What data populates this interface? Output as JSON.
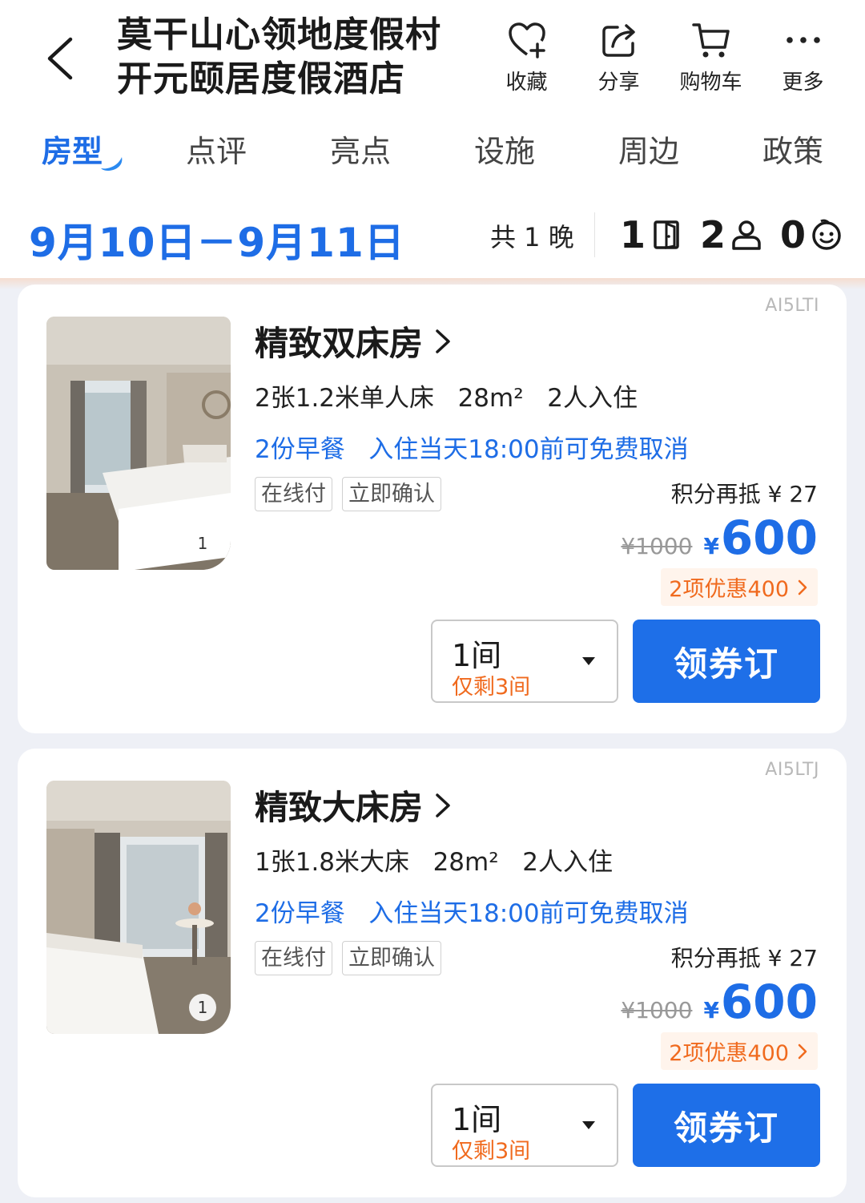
{
  "header": {
    "hotel_name_line1": "莫干山心领地度假村",
    "hotel_name_line2": "开元颐居度假酒店",
    "actions": [
      {
        "label": "收藏",
        "icon": "heart-plus-icon"
      },
      {
        "label": "分享",
        "icon": "share-icon"
      },
      {
        "label": "购物车",
        "icon": "cart-icon"
      },
      {
        "label": "更多",
        "icon": "more-icon"
      }
    ]
  },
  "tabs": [
    "房型",
    "点评",
    "亮点",
    "设施",
    "周边",
    "政策"
  ],
  "active_tab": "房型",
  "stay": {
    "date_range": "9月10日－9月11日",
    "nights": "共 1 晚",
    "rooms": "1",
    "adults": "2",
    "children": "0"
  },
  "rooms": [
    {
      "code": "AI5LTI",
      "name": "精致双床房",
      "spec": "2张1.2米单人床   28m²   2人入住",
      "perk": "2份早餐   入住当天18:00前可免费取消",
      "tags": [
        "在线付",
        "立即确认"
      ],
      "points": "积分再抵 ¥ 27",
      "orig_price": "¥1000",
      "currency": "¥",
      "price": "600",
      "discount": "2项优惠400",
      "qty": "1间",
      "remaining": "仅剩3间",
      "book_label": "领券订",
      "image_badge": "1"
    },
    {
      "code": "AI5LTJ",
      "name": "精致大床房",
      "spec": "1张1.8米大床   28m²   2人入住",
      "perk": "2份早餐   入住当天18:00前可免费取消",
      "tags": [
        "在线付",
        "立即确认"
      ],
      "points": "积分再抵 ¥ 27",
      "orig_price": "¥1000",
      "currency": "¥",
      "price": "600",
      "discount": "2项优惠400",
      "qty": "1间",
      "remaining": "仅剩3间",
      "book_label": "领券订",
      "image_badge": "1"
    }
  ],
  "colors": {
    "accent": "#1e6de6",
    "button": "#1e6fe8",
    "discount": "#f06a1e",
    "page_bg": "#eef0f6"
  }
}
